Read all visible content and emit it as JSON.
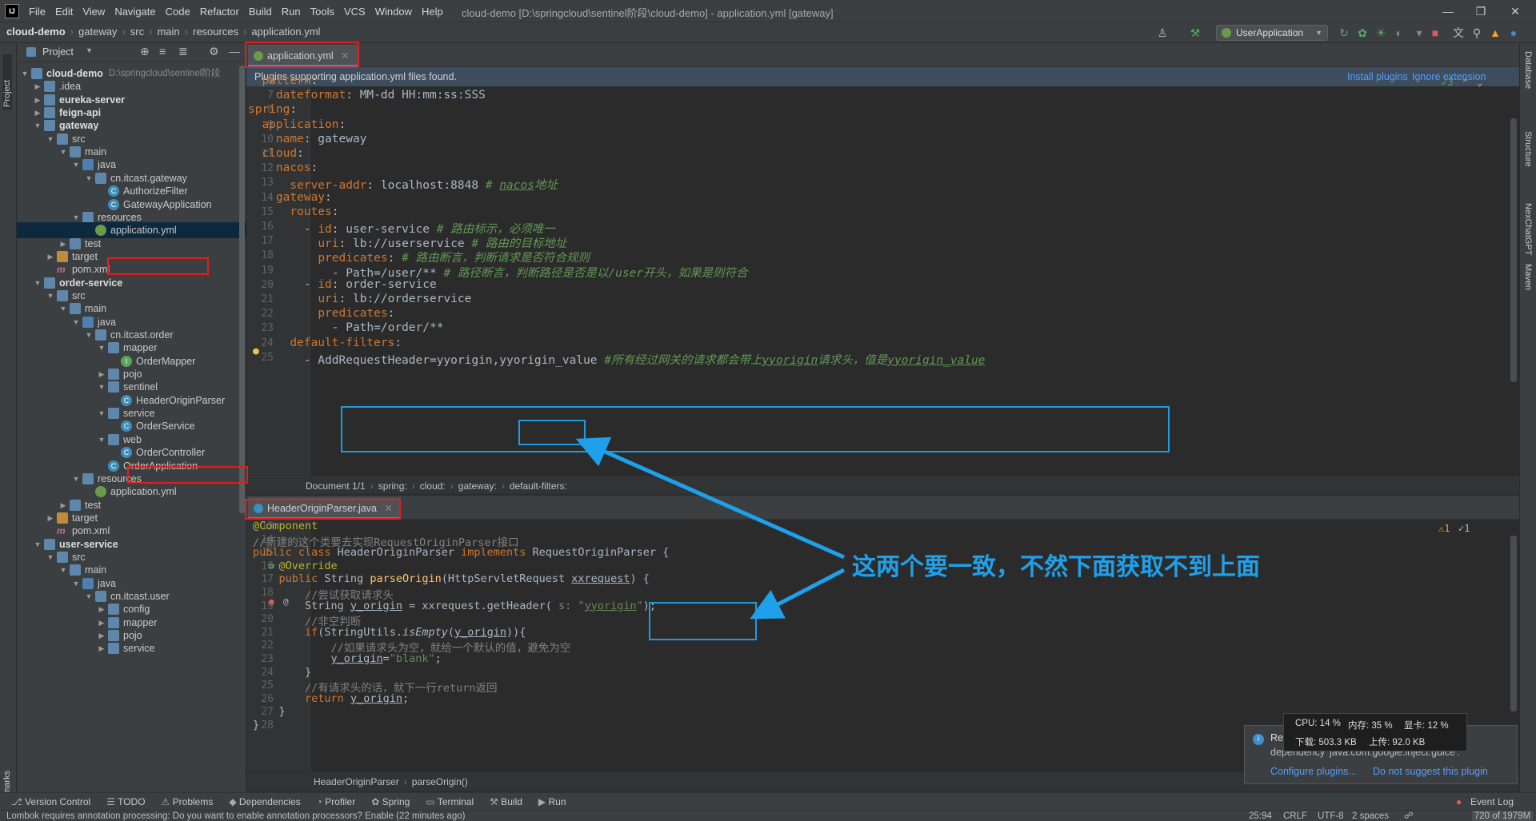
{
  "app": {
    "logo": "IJ",
    "menu": [
      "File",
      "Edit",
      "View",
      "Navigate",
      "Code",
      "Refactor",
      "Build",
      "Run",
      "Tools",
      "VCS",
      "Window",
      "Help"
    ],
    "window_title": "cloud-demo [D:\\springcloud\\sentinel阶段\\cloud-demo] - application.yml [gateway]"
  },
  "navbar": {
    "crumbs": [
      "cloud-demo",
      "gateway",
      "src",
      "main",
      "resources",
      "application.yml"
    ],
    "run_config": "UserApplication"
  },
  "left_strip": {
    "project": "Project",
    "bookmarks": "Bookmarks"
  },
  "right_strip": [
    "Database",
    "Structure",
    "NexChatGPT",
    "Maven"
  ],
  "project": {
    "header": "Project",
    "root_path": "D:\\springcloud\\sentinel阶段",
    "tree": [
      {
        "label": "cloud-demo",
        "bold": true,
        "icon": "module",
        "arrow": "down",
        "depth": 0
      },
      {
        "label": ".idea",
        "icon": "folder",
        "arrow": "right",
        "depth": 1
      },
      {
        "label": "eureka-server",
        "bold": true,
        "icon": "module",
        "arrow": "right",
        "depth": 1
      },
      {
        "label": "feign-api",
        "bold": true,
        "icon": "module",
        "arrow": "right",
        "depth": 1
      },
      {
        "label": "gateway",
        "bold": true,
        "icon": "module",
        "arrow": "down",
        "depth": 1
      },
      {
        "label": "src",
        "icon": "folder",
        "arrow": "down",
        "depth": 2
      },
      {
        "label": "main",
        "icon": "folder",
        "arrow": "down",
        "depth": 3
      },
      {
        "label": "java",
        "icon": "src",
        "arrow": "down",
        "depth": 4
      },
      {
        "label": "cn.itcast.gateway",
        "icon": "folder",
        "arrow": "down",
        "depth": 5
      },
      {
        "label": "AuthorizeFilter",
        "icon": "class",
        "depth": 6
      },
      {
        "label": "GatewayApplication",
        "icon": "class",
        "depth": 6
      },
      {
        "label": "resources",
        "icon": "folder",
        "arrow": "down",
        "depth": 4
      },
      {
        "label": "application.yml",
        "icon": "yml",
        "depth": 5,
        "selected": true
      },
      {
        "label": "test",
        "icon": "folder",
        "arrow": "right",
        "depth": 3
      },
      {
        "label": "target",
        "icon": "target",
        "arrow": "right",
        "depth": 2
      },
      {
        "label": "pom.xml",
        "icon": "maven",
        "depth": 2
      },
      {
        "label": "order-service",
        "bold": true,
        "icon": "module",
        "arrow": "down",
        "depth": 1
      },
      {
        "label": "src",
        "icon": "folder",
        "arrow": "down",
        "depth": 2
      },
      {
        "label": "main",
        "icon": "folder",
        "arrow": "down",
        "depth": 3
      },
      {
        "label": "java",
        "icon": "src",
        "arrow": "down",
        "depth": 4
      },
      {
        "label": "cn.itcast.order",
        "icon": "folder",
        "arrow": "down",
        "depth": 5
      },
      {
        "label": "mapper",
        "icon": "folder",
        "arrow": "down",
        "depth": 6
      },
      {
        "label": "OrderMapper",
        "icon": "iface",
        "depth": 7
      },
      {
        "label": "pojo",
        "icon": "folder",
        "arrow": "right",
        "depth": 6
      },
      {
        "label": "sentinel",
        "icon": "folder",
        "arrow": "down",
        "depth": 6
      },
      {
        "label": "HeaderOriginParser",
        "icon": "class",
        "depth": 7
      },
      {
        "label": "service",
        "icon": "folder",
        "arrow": "down",
        "depth": 6
      },
      {
        "label": "OrderService",
        "icon": "class",
        "depth": 7
      },
      {
        "label": "web",
        "icon": "folder",
        "arrow": "down",
        "depth": 6
      },
      {
        "label": "OrderController",
        "icon": "class",
        "depth": 7
      },
      {
        "label": "OrderApplication",
        "icon": "class",
        "depth": 6
      },
      {
        "label": "resources",
        "icon": "folder",
        "arrow": "down",
        "depth": 4
      },
      {
        "label": "application.yml",
        "icon": "yml",
        "depth": 5
      },
      {
        "label": "test",
        "icon": "folder",
        "arrow": "right",
        "depth": 3
      },
      {
        "label": "target",
        "icon": "target",
        "arrow": "right",
        "depth": 2
      },
      {
        "label": "pom.xml",
        "icon": "maven",
        "depth": 2
      },
      {
        "label": "user-service",
        "bold": true,
        "icon": "module",
        "arrow": "down",
        "depth": 1
      },
      {
        "label": "src",
        "icon": "folder",
        "arrow": "down",
        "depth": 2
      },
      {
        "label": "main",
        "icon": "folder",
        "arrow": "down",
        "depth": 3
      },
      {
        "label": "java",
        "icon": "src",
        "arrow": "down",
        "depth": 4
      },
      {
        "label": "cn.itcast.user",
        "icon": "folder",
        "arrow": "down",
        "depth": 5
      },
      {
        "label": "config",
        "icon": "folder",
        "arrow": "right",
        "depth": 6
      },
      {
        "label": "mapper",
        "icon": "folder",
        "arrow": "right",
        "depth": 6
      },
      {
        "label": "pojo",
        "icon": "folder",
        "arrow": "right",
        "depth": 6
      },
      {
        "label": "service",
        "icon": "folder",
        "arrow": "right",
        "depth": 6
      }
    ]
  },
  "editor1": {
    "tab": "application.yml",
    "banner": "Plugins supporting application.yml files found.",
    "banner_install": "Install plugins",
    "banner_ignore": "Ignore extension",
    "inspection": "3",
    "lines": [
      {
        "n": "6",
        "html": "  <span class=\"k\">pattern</span><span class=\"g\">:</span>"
      },
      {
        "n": "7",
        "html": "    <span class=\"k\">dateformat</span><span class=\"g\">:</span> MM-dd HH:mm:ss:SSS"
      },
      {
        "n": "8",
        "html": "<span class=\"k\">spring</span><span class=\"g\">:</span>"
      },
      {
        "n": "9",
        "html": "  <span class=\"k\">application</span><span class=\"g\">:</span>"
      },
      {
        "n": "10",
        "html": "    <span class=\"k\">name</span><span class=\"g\">:</span> gateway"
      },
      {
        "n": "11",
        "html": "  <span class=\"k\">cloud</span><span class=\"g\">:</span>"
      },
      {
        "n": "12",
        "html": "    <span class=\"k\">nacos</span><span class=\"g\">:</span>"
      },
      {
        "n": "13",
        "html": "      <span class=\"k\">server-addr</span><span class=\"g\">:</span> localhost:8848 <span class=\"c\"># <u>nacos</u>地址</span>"
      },
      {
        "n": "14",
        "html": "    <span class=\"k\">gateway</span><span class=\"g\">:</span>"
      },
      {
        "n": "15",
        "html": "      <span class=\"k\">routes</span><span class=\"g\">:</span>"
      },
      {
        "n": "16",
        "html": "        - <span class=\"k\">id</span><span class=\"g\">:</span> user-service <span class=\"c\"># 路由标示，必须唯一</span>"
      },
      {
        "n": "17",
        "html": "          <span class=\"k\">uri</span><span class=\"g\">:</span> lb://userservice <span class=\"c\"># 路由的目标地址</span>"
      },
      {
        "n": "18",
        "html": "          <span class=\"k\">predicates</span><span class=\"g\">:</span> <span class=\"c\"># 路由断言，判断请求是否符合规则</span>"
      },
      {
        "n": "19",
        "html": "            - Path=/user/** <span class=\"c\"># 路径断言，判断路径是否是以/user开头，如果是则符合</span>"
      },
      {
        "n": "20",
        "html": "        - <span class=\"k\">id</span><span class=\"g\">:</span> order-service"
      },
      {
        "n": "21",
        "html": "          <span class=\"k\">uri</span><span class=\"g\">:</span> lb://orderservice"
      },
      {
        "n": "22",
        "html": "          <span class=\"k\">predicates</span><span class=\"g\">:</span>"
      },
      {
        "n": "23",
        "html": "            - Path=/order/**"
      },
      {
        "n": "24",
        "html": "      <span class=\"k\">default-filters</span><span class=\"g\">:</span>"
      },
      {
        "n": "25",
        "html": "        - AddRequestHeader=yyorigin,yyorigin_value <span class=\"c\">#所有经过网关的请求都会带上<u>yyorigin</u>请求头，值是<u>yyorigin_value</u></span>"
      }
    ],
    "breadcrumb": [
      "Document 1/1",
      "spring:",
      "cloud:",
      "gateway:",
      "default-filters:"
    ]
  },
  "editor2": {
    "tab": "HeaderOriginParser.java",
    "warnings": "1",
    "weak": "1",
    "lines": [
      {
        "n": "13",
        "html": "<span class=\"ann\">@Component</span>"
      },
      {
        "n": "14",
        "html": "<span class=\"cm\">//新建的这个类要去实现RequestOriginParser接口</span>"
      },
      {
        "n": "15",
        "html": "<span class=\"k\">public class</span> HeaderOriginParser <span class=\"k\">implements</span> RequestOriginParser {"
      },
      {
        "n": "16",
        "html": "    <span class=\"ann\">@Override</span>"
      },
      {
        "n": "17",
        "html": "    <span class=\"k\">public</span> String <span class=\"fn\">parseOrigin</span>(HttpServletRequest <u>xxrequest</u>) {"
      },
      {
        "n": "18",
        "html": "        <span class=\"cm\">//尝试获取请求头</span>"
      },
      {
        "n": "19",
        "html": "        String <u>y_origin</u> = xxrequest.getHeader( <span class=\"cm\">s:</span> <span class=\"s\">\"<u>yyorigin</u>\"</span>);"
      },
      {
        "n": "20",
        "html": "        <span class=\"cm\">//非空判断</span>"
      },
      {
        "n": "21",
        "html": "        <span class=\"k\">if</span>(StringUtils.<i>isEmpty</i>(<u>y_origin</u>)){"
      },
      {
        "n": "22",
        "html": "            <span class=\"cm\">//如果请求头为空，就给一个默认的值，避免为空</span>"
      },
      {
        "n": "23",
        "html": "            <u>y_origin</u>=<span class=\"s\">\"blank\"</span>;"
      },
      {
        "n": "24",
        "html": "        }"
      },
      {
        "n": "25",
        "html": "        <span class=\"cm\">//有请求头的话，就下一行return返回</span>"
      },
      {
        "n": "26",
        "html": "        <span class=\"k\">return</span> <u>y_origin</u>;"
      },
      {
        "n": "27",
        "html": "    }"
      },
      {
        "n": "28",
        "html": "}"
      }
    ],
    "breadcrumb": [
      "HeaderOriginParser",
      "parseOrigin()"
    ]
  },
  "annotation": "这两个要一致，不然下面获取不到上面",
  "sysmon": {
    "cpu": "CPU: 14 %",
    "mem": "内存: 35 %",
    "gpu": "显卡: 12 %",
    "down": "下载: 503.3 KB",
    "up": "上传: 92.0 KB"
  },
  "notification": {
    "title_fragment": "Rec",
    "body_fragment": "dependency 'java:com.google.inject:guice'.",
    "configure": "Configure plugins...",
    "dont_suggest": "Do not suggest this plugin"
  },
  "bottom_tools": [
    "Version Control",
    "TODO",
    "Problems",
    "Dependencies",
    "Profiler",
    "Spring",
    "Terminal",
    "Build",
    "Run"
  ],
  "event_log": "Event Log",
  "status": {
    "message": "Lombok requires annotation processing: Do you want to enable annotation processors? Enable (22 minutes ago)",
    "position": "25:94",
    "line_sep": "CRLF",
    "encoding": "UTF-8",
    "indent": "2 spaces",
    "memory": "720 of 1979M"
  },
  "colors": {
    "accent": "#4a88c7",
    "highlight_red": "#e02020",
    "annotation_blue": "#1fa0ea"
  }
}
